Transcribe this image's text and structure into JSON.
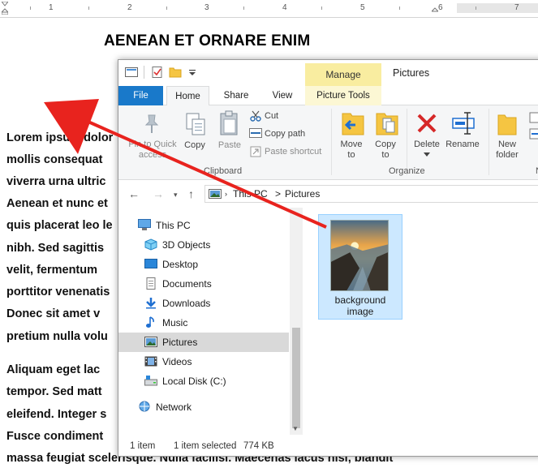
{
  "ruler": {
    "numbers": [
      "1",
      "2",
      "3",
      "4",
      "5",
      "6",
      "7"
    ]
  },
  "document": {
    "title": "AENEAN ET ORNARE ENIM",
    "lines": [
      "Lorem ipsum dolor",
      "mollis consequat",
      "viverra urna ultric",
      "Aenean et nunc et",
      "quis placerat leo le",
      "nibh. Sed sagittis",
      "velit,  fermentum",
      "porttitor venenatis",
      "Donec sit amet v",
      "pretium nulla volu",
      "Aliquam eget lac",
      "tempor. Sed matt",
      "eleifend. Integer s",
      "Fusce condiment",
      "massa feugiat scelerisque. Nulla facilisi. Maecenas lacus nisl, blandit"
    ]
  },
  "explorer": {
    "title": "Pictures",
    "contextual_tab": "Manage",
    "tabs": {
      "file": "File",
      "home": "Home",
      "share": "Share",
      "view": "View",
      "picture_tools": "Picture Tools"
    },
    "ribbon": {
      "pin_line1": "Pin to Quick",
      "pin_line2": "access",
      "copy": "Copy",
      "paste": "Paste",
      "cut": "Cut",
      "copy_path": "Copy path",
      "paste_shortcut": "Paste shortcut",
      "clipboard_group": "Clipboard",
      "move_to_1": "Move",
      "move_to_2": "to",
      "copy_to_1": "Copy",
      "copy_to_2": "to",
      "delete": "Delete",
      "rename": "Rename",
      "new_folder_1": "New",
      "new_folder_2": "folder",
      "organize_group": "Organize",
      "new_group": "N"
    },
    "address": {
      "part1": "This PC",
      "separator": ">",
      "part2": "Pictures"
    },
    "nav_items": [
      {
        "label": "This PC",
        "icon": "computer-icon"
      },
      {
        "label": "3D Objects",
        "icon": "cube-icon"
      },
      {
        "label": "Desktop",
        "icon": "desktop-icon"
      },
      {
        "label": "Documents",
        "icon": "document-icon"
      },
      {
        "label": "Downloads",
        "icon": "download-icon"
      },
      {
        "label": "Music",
        "icon": "music-note-icon"
      },
      {
        "label": "Pictures",
        "icon": "pictures-icon",
        "selected": true
      },
      {
        "label": "Videos",
        "icon": "film-icon"
      },
      {
        "label": "Local Disk (C:)",
        "icon": "drive-icon"
      },
      {
        "label": "Network",
        "icon": "network-icon"
      }
    ],
    "file": {
      "name_line1": "background",
      "name_line2": "image"
    },
    "status": {
      "count": "1 item",
      "selected": "1 item selected",
      "size": "774 KB"
    }
  },
  "colors": {
    "file_tab": "#1979ca",
    "manage_tab": "#f9eda0",
    "selection": "#cce8ff",
    "arrow": "#e8231e"
  }
}
